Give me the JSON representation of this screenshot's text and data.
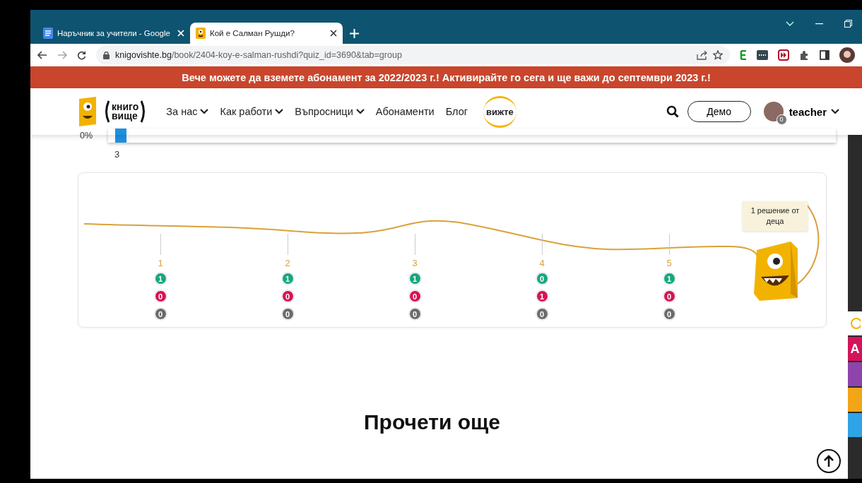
{
  "browser": {
    "tabs": [
      {
        "title": "Наръчник за учители - Google",
        "kind": "doc",
        "selected": false
      },
      {
        "title": "Кой е Салман Рушди?",
        "kind": "site",
        "selected": true
      }
    ],
    "url": {
      "domain": "knigovishte.bg",
      "path": "/book/2404-koy-e-salman-rushdi?quiz_id=3690&tab=group"
    }
  },
  "banner": "Вече можете да вземете абонамент за 2022/2023 г.! Активирайте го сега и ще важи до септември 2023 г.!",
  "header": {
    "logo": [
      "книго",
      "вище"
    ],
    "nav": [
      {
        "label": "За нас",
        "dropdown": true
      },
      {
        "label": "Как работи",
        "dropdown": true
      },
      {
        "label": "Въпросници",
        "dropdown": true
      },
      {
        "label": "Абонаменти",
        "dropdown": false
      },
      {
        "label": "Блог",
        "dropdown": false
      }
    ],
    "vizhte": "вижте",
    "demo": "Демо",
    "user": "teacher",
    "user_badge": "0"
  },
  "chart_remnant": {
    "y_tick": "0%",
    "category": "3"
  },
  "timeline": {
    "questions": [
      {
        "number": "1",
        "correct": "1",
        "wrong": "0",
        "unanswered": "0"
      },
      {
        "number": "2",
        "correct": "1",
        "wrong": "0",
        "unanswered": "0"
      },
      {
        "number": "3",
        "correct": "1",
        "wrong": "0",
        "unanswered": "0"
      },
      {
        "number": "4",
        "correct": "0",
        "wrong": "1",
        "unanswered": "0"
      },
      {
        "number": "5",
        "correct": "1",
        "wrong": "0",
        "unanswered": "0"
      }
    ],
    "bubble": "1 решение от деца"
  },
  "heading": "Прочети още",
  "side_tabs": [
    {
      "color": "#d4145a",
      "text": "A"
    },
    {
      "color": "#8e44ad"
    },
    {
      "color": "#f2a516"
    },
    {
      "color": "#2ea3e6"
    }
  ]
}
